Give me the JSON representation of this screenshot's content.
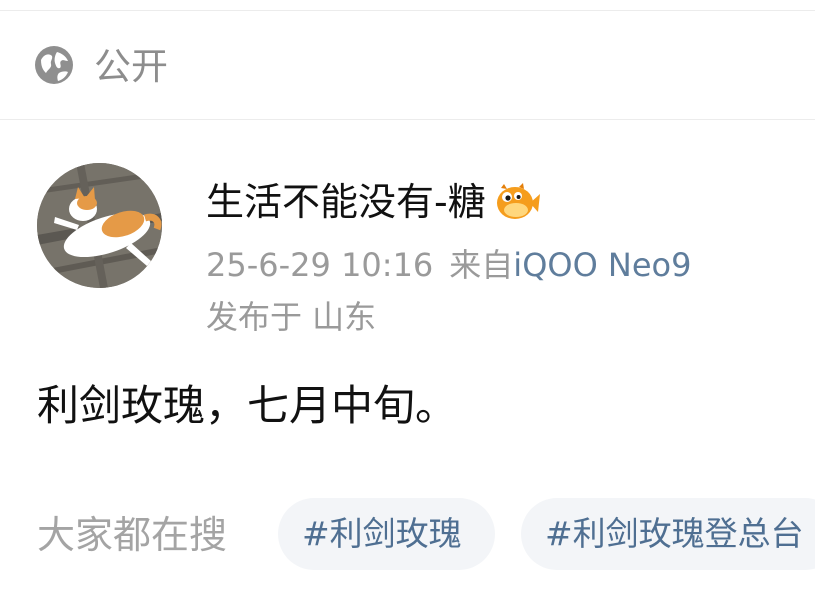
{
  "visibility": {
    "label": "公开",
    "icon": "globe-icon"
  },
  "post": {
    "author": "生活不能没有-糖",
    "author_badge_icon": "pufferfish-icon",
    "timestamp": "25-6-29 10:16",
    "source_prefix": "来自",
    "device": "iQOO Neo9",
    "location": "发布于 山东",
    "text": "利剑玫瑰，七月中旬。"
  },
  "trending": {
    "label": "大家都在搜",
    "tags": [
      "#利剑玫瑰",
      "#利剑玫瑰登总台"
    ]
  },
  "colors": {
    "secondary_text": "#9a9a9a",
    "link_blue": "#5f7d9c",
    "chip_background": "#f3f5f8"
  }
}
